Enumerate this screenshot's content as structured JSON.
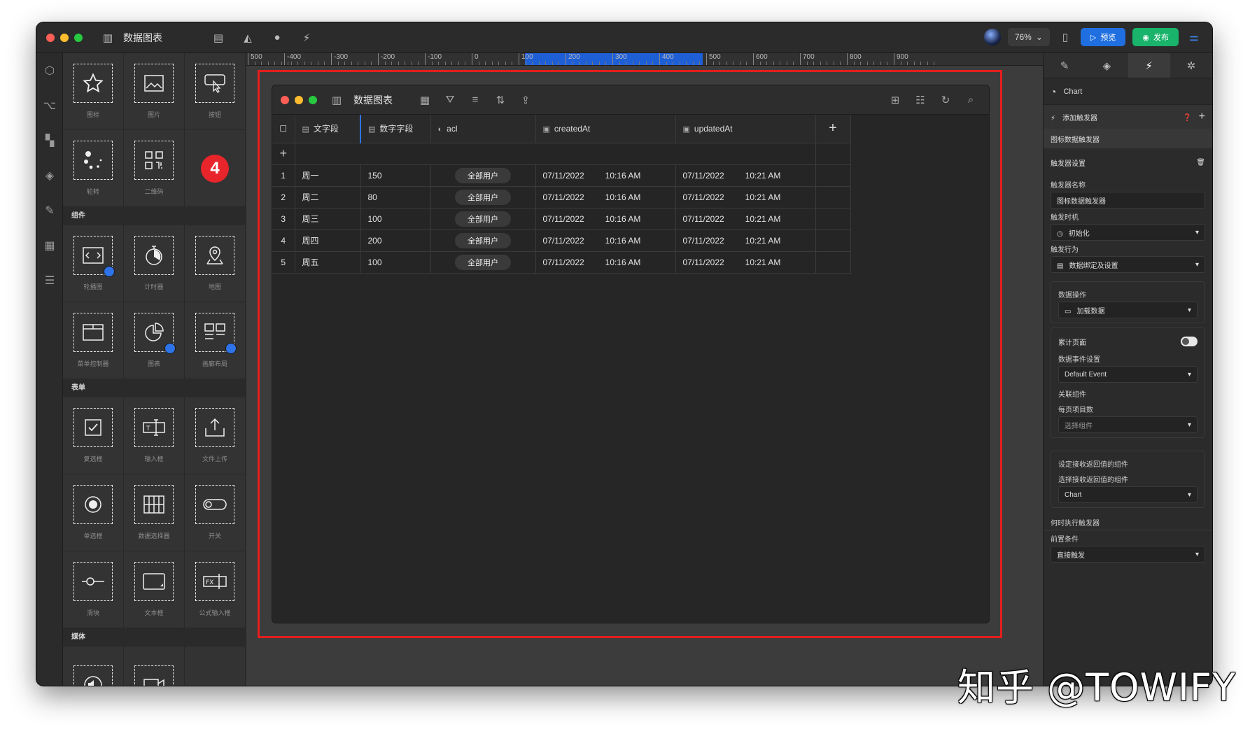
{
  "app": {
    "title": "数据图表",
    "zoom": "76%",
    "preview_label": "预览",
    "publish_label": "发布"
  },
  "components": {
    "top_items": [
      {
        "label": "图标",
        "icon": "star-icon"
      },
      {
        "label": "图片",
        "icon": "image-icon"
      },
      {
        "label": "按钮",
        "icon": "button-click-icon"
      },
      {
        "label": "轮转",
        "icon": "spinner-icon"
      },
      {
        "label": "二维码",
        "icon": "qr-code-icon"
      }
    ],
    "badge": "4",
    "sections": [
      {
        "title": "组件",
        "items": [
          {
            "label": "轮播图",
            "icon": "carousel-icon"
          },
          {
            "label": "计时器",
            "icon": "timer-icon"
          },
          {
            "label": "地图",
            "icon": "map-pin-icon"
          },
          {
            "label": "菜单控制器",
            "icon": "menu-controller-icon"
          },
          {
            "label": "图表",
            "icon": "pie-chart-icon"
          },
          {
            "label": "画廊布局",
            "icon": "gallery-layout-icon"
          }
        ]
      },
      {
        "title": "表单",
        "items": [
          {
            "label": "复选框",
            "icon": "checkbox-icon"
          },
          {
            "label": "输入框",
            "icon": "text-input-icon"
          },
          {
            "label": "文件上传",
            "icon": "upload-icon"
          },
          {
            "label": "单选框",
            "icon": "radio-icon"
          },
          {
            "label": "数据选择器",
            "icon": "data-picker-icon"
          },
          {
            "label": "开关",
            "icon": "switch-icon"
          },
          {
            "label": "滑块",
            "icon": "slider-icon"
          },
          {
            "label": "文本框",
            "icon": "textarea-icon"
          },
          {
            "label": "公式输入框",
            "icon": "formula-input-icon"
          }
        ]
      },
      {
        "title": "媒体",
        "items": [
          {
            "label": "",
            "icon": "audio-icon"
          },
          {
            "label": "",
            "icon": "video-icon"
          }
        ]
      }
    ]
  },
  "ruler": {
    "ticks": [
      "500",
      "-400",
      "-300",
      "-200",
      "-100",
      "0",
      "100",
      "200",
      "300",
      "400",
      "500",
      "600",
      "700",
      "800",
      "900"
    ]
  },
  "window": {
    "title": "数据图表",
    "columns": [
      "文字段",
      "数字字段",
      "acl",
      "createdAt",
      "updatedAt"
    ],
    "rows": [
      {
        "n": "1",
        "text": "周一",
        "num": "150",
        "acl": "全部用户",
        "cd": "07/11/2022",
        "ct": "10:16 AM",
        "ud": "07/11/2022",
        "ut": "10:21 AM"
      },
      {
        "n": "2",
        "text": "周二",
        "num": "80",
        "acl": "全部用户",
        "cd": "07/11/2022",
        "ct": "10:16 AM",
        "ud": "07/11/2022",
        "ut": "10:21 AM"
      },
      {
        "n": "3",
        "text": "周三",
        "num": "100",
        "acl": "全部用户",
        "cd": "07/11/2022",
        "ct": "10:16 AM",
        "ud": "07/11/2022",
        "ut": "10:21 AM"
      },
      {
        "n": "4",
        "text": "周四",
        "num": "200",
        "acl": "全部用户",
        "cd": "07/11/2022",
        "ct": "10:16 AM",
        "ud": "07/11/2022",
        "ut": "10:21 AM"
      },
      {
        "n": "5",
        "text": "周五",
        "num": "100",
        "acl": "全部用户",
        "cd": "07/11/2022",
        "ct": "10:16 AM",
        "ud": "07/11/2022",
        "ut": "10:21 AM"
      }
    ]
  },
  "props": {
    "selected": "Chart",
    "add_trigger": "添加触发器",
    "trigger_title": "图标数据触发器",
    "settings_title": "触发器设置",
    "name_label": "触发器名称",
    "name_value": "图标数据触发器",
    "timing_label": "触发时机",
    "timing_value": "初始化",
    "action_label": "触发行为",
    "action_value": "数据绑定及设置",
    "data_op_label": "数据操作",
    "data_op_value": "加载数据",
    "cumulative_label": "累计页面",
    "event_label": "数据事件设置",
    "event_value": "Default Event",
    "related_label": "关联组件",
    "per_page_label": "每页项目数",
    "per_page_value": "选择组件",
    "return_label": "设定接收返回值的组件",
    "return_select_label": "选择接收返回值的组件",
    "return_value": "Chart",
    "when_label": "何时执行触发器",
    "pre_label": "前置条件",
    "pre_value": "直接触发"
  },
  "watermark": "知乎 @TOWIFY"
}
